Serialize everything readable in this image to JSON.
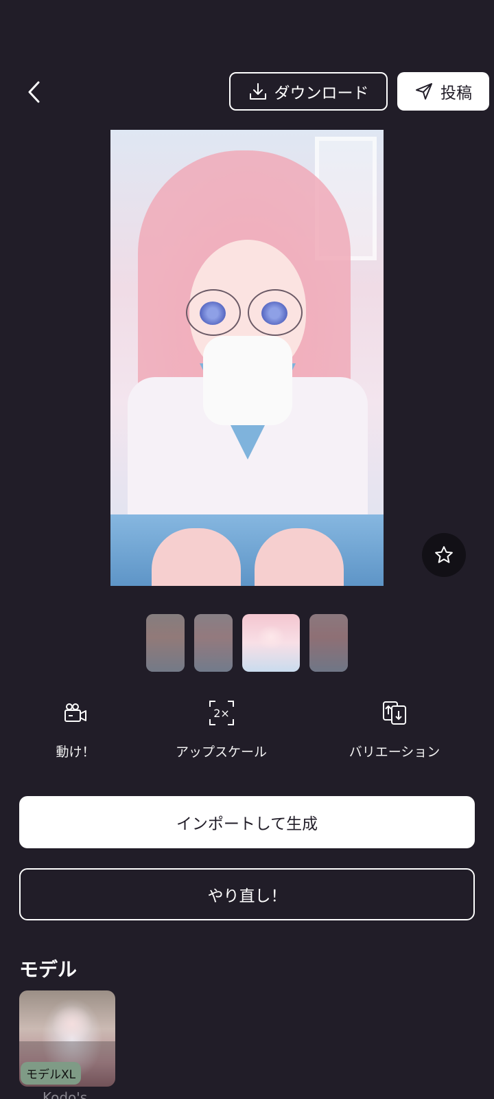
{
  "header": {
    "download_label": "ダウンロード",
    "post_label": "投稿"
  },
  "actions": [
    {
      "label": "動け！",
      "icon": "video-camera-icon"
    },
    {
      "label": "アップスケール",
      "icon": "upscale-2x-icon"
    },
    {
      "label": "バリエーション",
      "icon": "variation-icon"
    }
  ],
  "upscale_icon_text": "2×",
  "buttons": {
    "import_generate": "インポートして生成",
    "redo": "やり直し！"
  },
  "model_section": {
    "title": "モデル",
    "badge": "モデルXL",
    "name": "Kodo's"
  },
  "colors": {
    "background": "#211d28",
    "button_fill": "#ffffff",
    "favorite_bg": "#121016",
    "badge_bg": "#7f9b86"
  },
  "thumbnails": {
    "count": 4,
    "selected_index": 2
  }
}
